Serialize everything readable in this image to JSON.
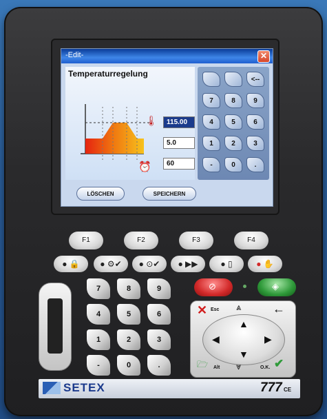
{
  "window": {
    "title": "-Edit-",
    "close_symbol": "✕"
  },
  "screen": {
    "heading": "Temperaturregelung",
    "fields": {
      "temperature": "115.00",
      "rate": "5.0",
      "time": "60"
    },
    "buttons": {
      "clear": "LÖSCHEN",
      "save": "SPEICHERN"
    },
    "keypad": [
      "",
      "",
      "<--",
      "7",
      "8",
      "9",
      "4",
      "5",
      "6",
      "1",
      "2",
      "3",
      "-",
      "0",
      "."
    ]
  },
  "function_keys": [
    "F1",
    "F2",
    "F3",
    "F4"
  ],
  "numeric_keys": [
    "7",
    "8",
    "9",
    "4",
    "5",
    "6",
    "1",
    "2",
    "3",
    "-",
    "0",
    "."
  ],
  "nav": {
    "esc": "Esc",
    "alt": "Alt",
    "ok": "O.K."
  },
  "brand": {
    "name": "SETEX",
    "model": "777",
    "model_suffix": "CE"
  },
  "colors": {
    "stop": "#d22a2a",
    "start": "#2f9a3a",
    "title_bar": "#1f5fcf",
    "esc_cross": "#d11d1d",
    "ok_check": "#2f9a3a"
  },
  "icons": [
    "lock-icon",
    "tool-check-icon",
    "timer-check-icon",
    "fast-forward-icon",
    "door-icon",
    "hand-stop-icon",
    "stop-icon",
    "start-icon",
    "thermometer-icon",
    "clock-icon",
    "page-up-icon",
    "page-down-icon",
    "folder-icon",
    "card-slot-icon"
  ]
}
